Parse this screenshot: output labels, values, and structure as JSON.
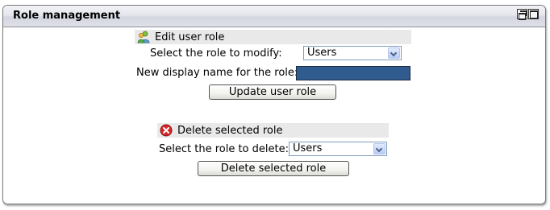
{
  "panel": {
    "title": "Role management"
  },
  "edit_section": {
    "heading": "Edit user role",
    "icon": "users-icon",
    "select_label": "Select the role to modify:",
    "select_value": "Users",
    "name_label": "New display name for the role:",
    "name_value": "",
    "button_label": "Update user role"
  },
  "delete_section": {
    "heading": "Delete selected role",
    "icon": "delete-x-icon",
    "select_label": "Select the role to delete:",
    "select_value": "Users",
    "button_label": "Delete selected role"
  },
  "colors": {
    "input_fill": "#2f5b8f",
    "section_bg": "#e9e9e9",
    "delete_icon": "#d4272a"
  }
}
